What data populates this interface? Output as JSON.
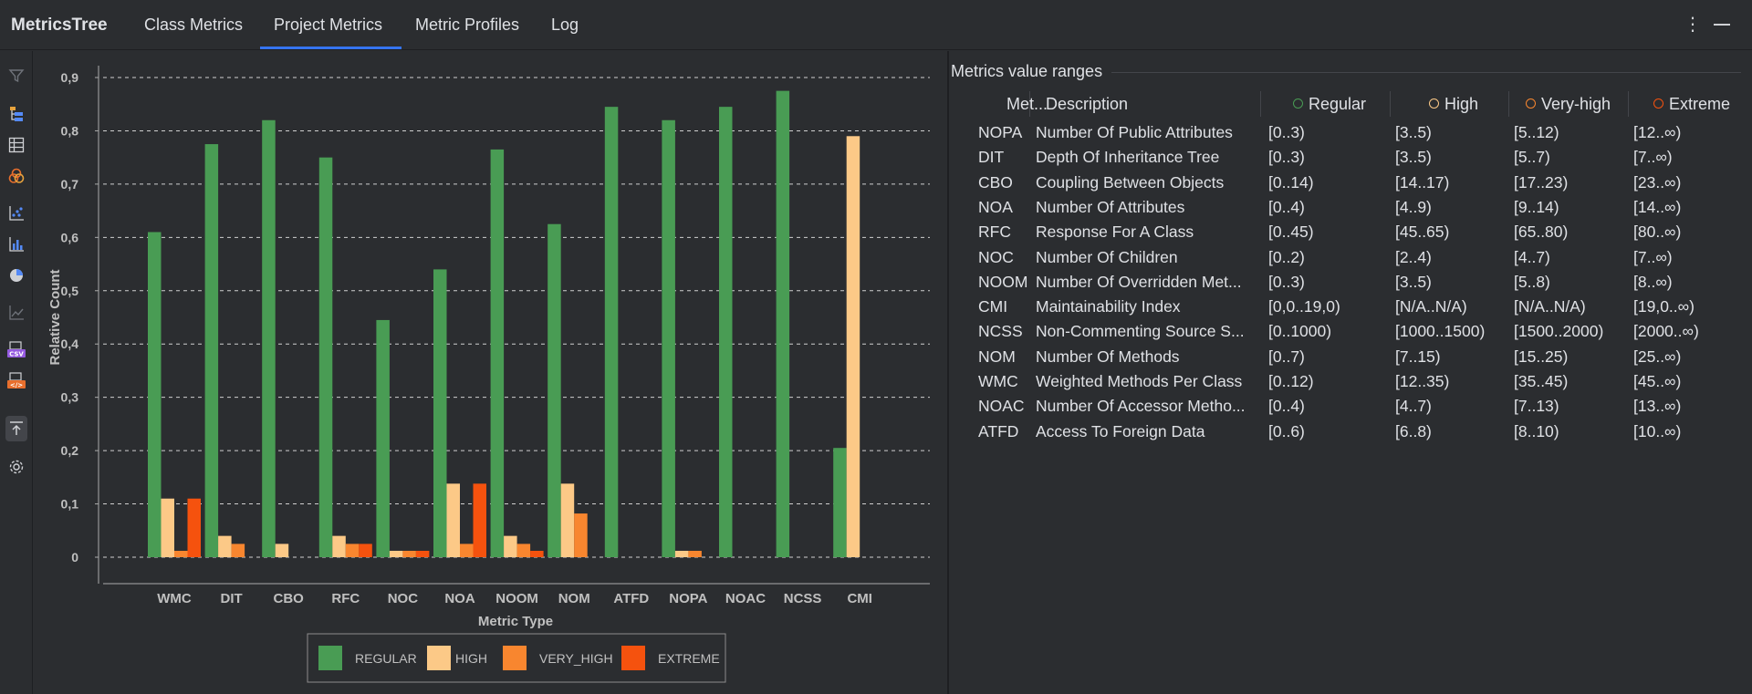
{
  "app": {
    "title": "MetricsTree"
  },
  "tabs": [
    {
      "label": "Class Metrics"
    },
    {
      "label": "Project Metrics"
    },
    {
      "label": "Metric Profiles"
    },
    {
      "label": "Log"
    }
  ],
  "active_tab": "Project Metrics",
  "colors": {
    "accent": "#3574f0",
    "regular": "#499c54",
    "high": "#fcc987",
    "very_high": "#f8862f",
    "extreme": "#f5520e"
  },
  "toolbar_icons": [
    "filter-icon",
    "tree-metrics-icon",
    "table-grid-icon",
    "venn-icon",
    "scatter-chart-icon",
    "bar-chart-icon",
    "pie-chart-icon",
    "line-chart-icon",
    "export-csv-icon",
    "export-xml-icon",
    "upload-icon",
    "settings-icon"
  ],
  "chart_data": {
    "type": "bar",
    "xlabel": "Metric Type",
    "ylabel": "Relative Count",
    "ylim": [
      0,
      0.9
    ],
    "yticks": [
      "0",
      "0,1",
      "0,2",
      "0,3",
      "0,4",
      "0,5",
      "0,6",
      "0,7",
      "0,8",
      "0,9"
    ],
    "grid": true,
    "legend_position": "bottom",
    "categories": [
      "WMC",
      "DIT",
      "CBO",
      "RFC",
      "NOC",
      "NOA",
      "NOOM",
      "NOM",
      "ATFD",
      "NOPA",
      "NOAC",
      "NCSS",
      "CMI"
    ],
    "series": [
      {
        "name": "REGULAR",
        "color": "#499c54",
        "values": [
          0.61,
          0.775,
          0.82,
          0.75,
          0.445,
          0.54,
          0.765,
          0.625,
          0.845,
          0.82,
          0.845,
          0.875,
          0.205
        ]
      },
      {
        "name": "HIGH",
        "color": "#fcc987",
        "values": [
          0.11,
          0.04,
          0.025,
          0.04,
          0.012,
          0.138,
          0.04,
          0.138,
          0,
          0.012,
          0,
          0,
          0.79
        ]
      },
      {
        "name": "VERY_HIGH",
        "color": "#f8862f",
        "values": [
          0.012,
          0.025,
          0,
          0.025,
          0.012,
          0.025,
          0.025,
          0.082,
          0,
          0.012,
          0,
          0,
          0
        ]
      },
      {
        "name": "EXTREME",
        "color": "#f5520e",
        "values": [
          0.11,
          0,
          0,
          0.025,
          0.012,
          0.138,
          0.012,
          0,
          0,
          0,
          0,
          0,
          0
        ]
      }
    ]
  },
  "ranges_panel": {
    "title": "Metrics value ranges",
    "columns": {
      "metric": "Met...",
      "description": "Description",
      "regular": "Regular",
      "high": "High",
      "very_high": "Very-high",
      "extreme": "Extreme"
    },
    "rows": [
      {
        "metric": "NOPA",
        "description": "Number Of Public Attributes",
        "regular": "[0..3)",
        "high": "[3..5)",
        "very_high": "[5..12)",
        "extreme": "[12..∞)"
      },
      {
        "metric": "DIT",
        "description": "Depth Of Inheritance Tree",
        "regular": "[0..3)",
        "high": "[3..5)",
        "very_high": "[5..7)",
        "extreme": "[7..∞)"
      },
      {
        "metric": "CBO",
        "description": "Coupling Between Objects",
        "regular": "[0..14)",
        "high": "[14..17)",
        "very_high": "[17..23)",
        "extreme": "[23..∞)"
      },
      {
        "metric": "NOA",
        "description": "Number Of Attributes",
        "regular": "[0..4)",
        "high": "[4..9)",
        "very_high": "[9..14)",
        "extreme": "[14..∞)"
      },
      {
        "metric": "RFC",
        "description": "Response For A Class",
        "regular": "[0..45)",
        "high": "[45..65)",
        "very_high": "[65..80)",
        "extreme": "[80..∞)"
      },
      {
        "metric": "NOC",
        "description": "Number Of Children",
        "regular": "[0..2)",
        "high": "[2..4)",
        "very_high": "[4..7)",
        "extreme": "[7..∞)"
      },
      {
        "metric": "NOOM",
        "description": "Number Of Overridden Met...",
        "regular": "[0..3)",
        "high": "[3..5)",
        "very_high": "[5..8)",
        "extreme": "[8..∞)"
      },
      {
        "metric": "CMI",
        "description": "Maintainability Index",
        "regular": "[0,0..19,0)",
        "high": "[N/A..N/A)",
        "very_high": "[N/A..N/A)",
        "extreme": "[19,0..∞)"
      },
      {
        "metric": "NCSS",
        "description": "Non-Commenting Source S...",
        "regular": "[0..1000)",
        "high": "[1000..1500)",
        "very_high": "[1500..2000)",
        "extreme": "[2000..∞)"
      },
      {
        "metric": "NOM",
        "description": "Number Of Methods",
        "regular": "[0..7)",
        "high": "[7..15)",
        "very_high": "[15..25)",
        "extreme": "[25..∞)"
      },
      {
        "metric": "WMC",
        "description": "Weighted Methods Per Class",
        "regular": "[0..12)",
        "high": "[12..35)",
        "very_high": "[35..45)",
        "extreme": "[45..∞)"
      },
      {
        "metric": "NOAC",
        "description": "Number Of Accessor Metho...",
        "regular": "[0..4)",
        "high": "[4..7)",
        "very_high": "[7..13)",
        "extreme": "[13..∞)"
      },
      {
        "metric": "ATFD",
        "description": "Access To Foreign Data",
        "regular": "[0..6)",
        "high": "[6..8)",
        "very_high": "[8..10)",
        "extreme": "[10..∞)"
      }
    ]
  }
}
